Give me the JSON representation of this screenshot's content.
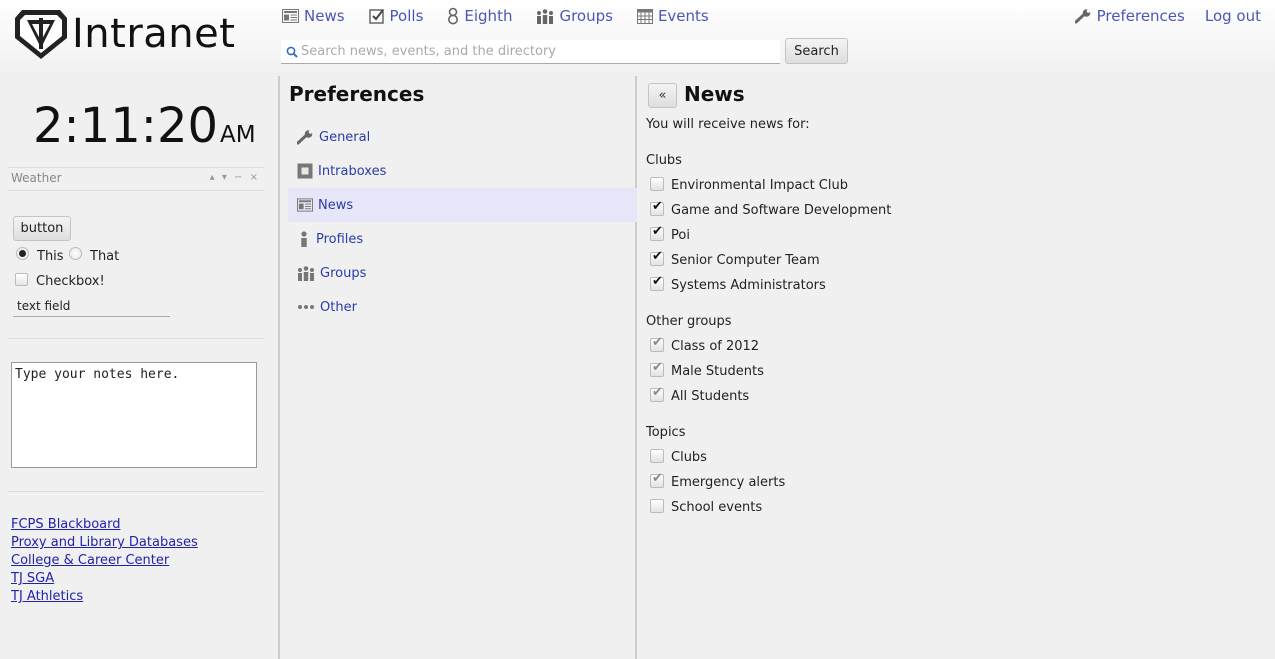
{
  "header": {
    "app_title": "Intranet",
    "nav": [
      {
        "label": "News",
        "icon": "newspaper-icon"
      },
      {
        "label": "Polls",
        "icon": "checkbox-icon"
      },
      {
        "label": "Eighth",
        "icon": "eight-icon"
      },
      {
        "label": "Groups",
        "icon": "people-icon"
      },
      {
        "label": "Events",
        "icon": "calendar-icon"
      }
    ],
    "nav_right": [
      {
        "label": "Preferences",
        "icon": "wrench-icon"
      },
      {
        "label": "Log out"
      }
    ],
    "search": {
      "placeholder": "Search news, events, and the directory",
      "button_label": "Search"
    }
  },
  "sidebar": {
    "clock": {
      "time": "2:11:20",
      "ampm": "AM"
    },
    "weather": {
      "title": "Weather",
      "controls": "▴ ▾ − ×"
    },
    "demo": {
      "button_label": "button",
      "radio_this": "This",
      "radio_that": "That",
      "radio_selected": "This",
      "checkbox_label": "Checkbox!",
      "checkbox_checked": false,
      "text_field_value": "text field"
    },
    "notes": {
      "value": "Type your notes here."
    },
    "links": [
      "FCPS Blackboard",
      "Proxy and Library Databases",
      "College & Career Center",
      "TJ SGA",
      "TJ Athletics"
    ]
  },
  "preferences": {
    "title": "Preferences",
    "menu": [
      {
        "label": "General",
        "icon": "wrench-icon"
      },
      {
        "label": "Intraboxes",
        "icon": "box-icon"
      },
      {
        "label": "News",
        "icon": "newspaper-icon",
        "active": true
      },
      {
        "label": "Profiles",
        "icon": "person-icon"
      },
      {
        "label": "Groups",
        "icon": "people-icon"
      },
      {
        "label": "Other",
        "icon": "ellipsis-icon"
      }
    ]
  },
  "news_panel": {
    "back_label": "«",
    "title": "News",
    "intro": "You will receive news for:",
    "sections": [
      {
        "title": "Clubs",
        "items": [
          {
            "label": "Environmental Impact Club",
            "checked": false,
            "disabled": false
          },
          {
            "label": "Game and Software Development",
            "checked": true,
            "disabled": false
          },
          {
            "label": "Poi",
            "checked": true,
            "disabled": false
          },
          {
            "label": "Senior Computer Team",
            "checked": true,
            "disabled": false
          },
          {
            "label": "Systems Administrators",
            "checked": true,
            "disabled": false
          }
        ]
      },
      {
        "title": "Other groups",
        "items": [
          {
            "label": "Class of 2012",
            "checked": true,
            "disabled": true
          },
          {
            "label": "Male Students",
            "checked": true,
            "disabled": true
          },
          {
            "label": "All Students",
            "checked": true,
            "disabled": true
          }
        ]
      },
      {
        "title": "Topics",
        "items": [
          {
            "label": "Clubs",
            "checked": false,
            "disabled": false
          },
          {
            "label": "Emergency alerts",
            "checked": true,
            "disabled": true
          },
          {
            "label": "School events",
            "checked": false,
            "disabled": false
          }
        ]
      }
    ]
  },
  "colors": {
    "link": "#2a3ca8",
    "nav": "#4a57b5",
    "active_row": "#e6e6f8",
    "background": "#f0f0f0"
  }
}
